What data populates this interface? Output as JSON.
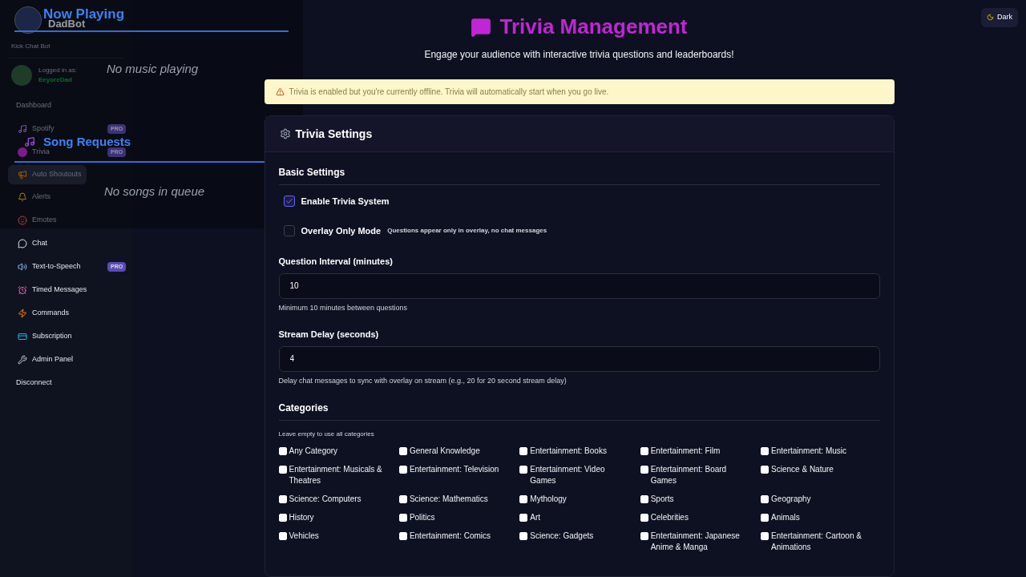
{
  "brand": {
    "name": "DadBot",
    "tagline": "Kick Chat Bot"
  },
  "user": {
    "label": "Logged in as:",
    "name": "EeyoreDad"
  },
  "nav": [
    {
      "label": "Dashboard",
      "selected": false
    },
    {
      "label": "Spotify",
      "badge": "PRO",
      "selected": false
    },
    {
      "label": "Trivia",
      "badge": "PRO",
      "selected": false
    },
    {
      "label": "Auto Shoutouts",
      "selected": true
    },
    {
      "label": "Alerts",
      "selected": false
    },
    {
      "label": "Emotes",
      "selected": false
    },
    {
      "label": "Chat",
      "selected": false
    },
    {
      "label": "Text-to-Speech",
      "badge": "PRO",
      "selected": false
    },
    {
      "label": "Timed Messages",
      "selected": false
    },
    {
      "label": "Commands",
      "selected": false
    },
    {
      "label": "Subscription",
      "selected": false
    },
    {
      "label": "Admin Panel",
      "selected": false
    },
    {
      "label": "Disconnect",
      "selected": false
    }
  ],
  "overlay": {
    "now_playing": {
      "title": "Now Playing",
      "message": "No music playing"
    },
    "song_requests": {
      "title": "Song Requests",
      "message": "No songs in queue"
    }
  },
  "theme_toggle": {
    "label": "Dark"
  },
  "header": {
    "title": "Trivia Management",
    "subtitle": "Engage your audience with interactive trivia questions and leaderboards!"
  },
  "alert": "Trivia is enabled but you're currently offline. Trivia will automatically start when you go live.",
  "settings": {
    "title": "Trivia Settings",
    "section": "Basic Settings",
    "toggles": [
      {
        "label": "Enable Trivia System",
        "checked": true
      },
      {
        "label": "Overlay Only Mode",
        "hint": "Questions appear only in overlay, no chat messages",
        "checked": false
      }
    ],
    "fields": [
      {
        "label": "Question Interval (minutes)",
        "value": "10",
        "help": "Minimum 10 minutes between questions"
      },
      {
        "label": "Stream Delay (seconds)",
        "value": "4",
        "help": "Delay chat messages to sync with overlay on stream (e.g., 20 for 20 second stream delay)"
      }
    ],
    "categories": {
      "title": "Categories",
      "help": "Leave empty to use all categories",
      "items": [
        {
          "label": "Any Category",
          "checked": false
        },
        {
          "label": "General Knowledge",
          "checked": false
        },
        {
          "label": "Entertainment: Books",
          "checked": false
        },
        {
          "label": "Entertainment: Film",
          "checked": false
        },
        {
          "label": "Entertainment: Music",
          "checked": false
        },
        {
          "label": "Entertainment: Musicals & Theatres",
          "checked": false
        },
        {
          "label": "Entertainment: Television",
          "checked": false
        },
        {
          "label": "Entertainment: Video Games",
          "checked": false
        },
        {
          "label": "Entertainment: Board Games",
          "checked": false
        },
        {
          "label": "Science & Nature",
          "checked": false
        },
        {
          "label": "Science: Computers",
          "checked": false
        },
        {
          "label": "Science: Mathematics",
          "checked": false
        },
        {
          "label": "Mythology",
          "checked": false
        },
        {
          "label": "Sports",
          "checked": false
        },
        {
          "label": "Geography",
          "checked": false
        },
        {
          "label": "History",
          "checked": false
        },
        {
          "label": "Politics",
          "checked": false
        },
        {
          "label": "Art",
          "checked": false
        },
        {
          "label": "Celebrities",
          "checked": false
        },
        {
          "label": "Animals",
          "checked": false
        },
        {
          "label": "Vehicles",
          "checked": false
        },
        {
          "label": "Entertainment: Comics",
          "checked": false
        },
        {
          "label": "Science: Gadgets",
          "checked": false
        },
        {
          "label": "Entertainment: Japanese Anime & Manga",
          "checked": false
        },
        {
          "label": "Entertainment: Cartoon & Animations",
          "checked": false
        }
      ]
    }
  }
}
